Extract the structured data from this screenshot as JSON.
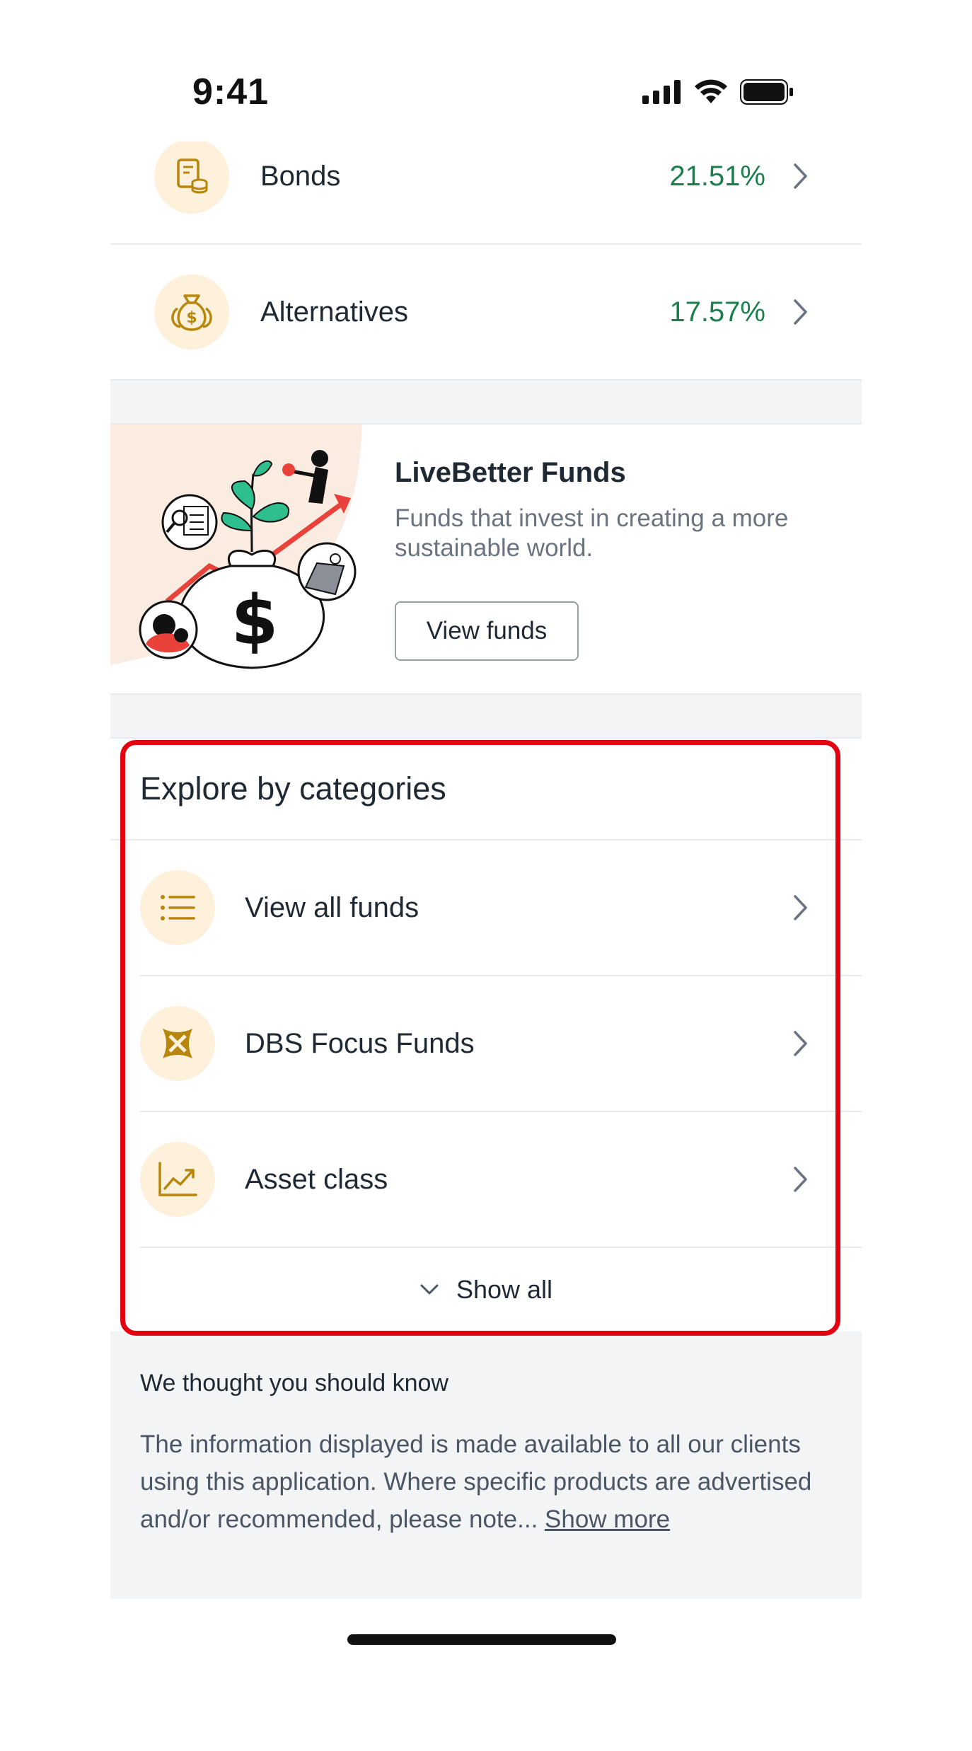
{
  "status_bar": {
    "time": "9:41"
  },
  "assets": [
    {
      "label": "Bonds",
      "percent": "21.51%",
      "icon": "bond-document-icon"
    },
    {
      "label": "Alternatives",
      "percent": "17.57%",
      "icon": "money-bag-icon"
    }
  ],
  "promo": {
    "title": "LiveBetter Funds",
    "description": "Funds that invest in creating a more sustainable world.",
    "button_label": "View funds"
  },
  "explore": {
    "title": "Explore by categories",
    "items": [
      {
        "label": "View all funds",
        "icon": "list-icon"
      },
      {
        "label": "DBS Focus Funds",
        "icon": "dbs-logo-icon"
      },
      {
        "label": "Asset class",
        "icon": "line-chart-icon"
      }
    ],
    "show_all_label": "Show all"
  },
  "info": {
    "title": "We thought you should know",
    "body": "The information displayed is made available to all our clients using this application. Where specific products are advertised and/or recommended, please note... ",
    "link": "Show more"
  },
  "colors": {
    "positive": "#1a7f4b",
    "icon_bg": "#fdf1dc",
    "icon_fg": "#b8860b",
    "highlight": "#e3000f"
  }
}
